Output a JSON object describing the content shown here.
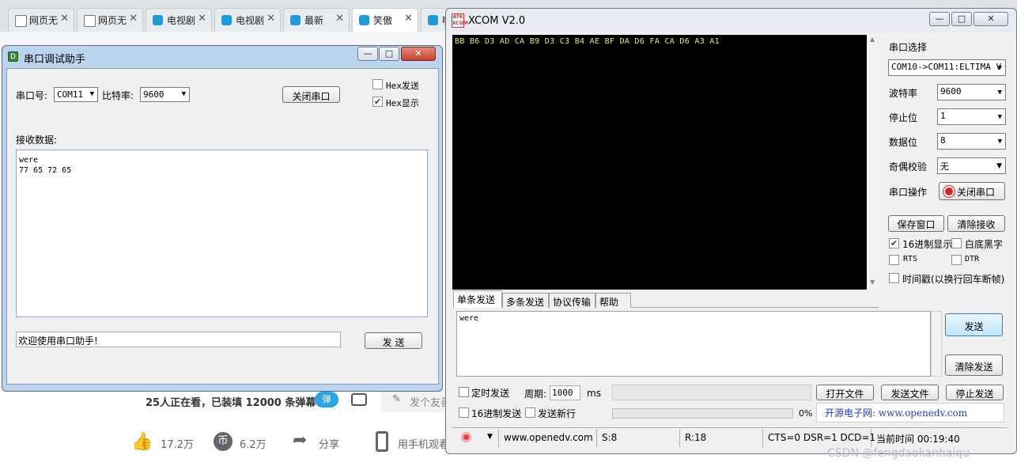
{
  "browser": {
    "tabs": [
      {
        "label": "网页无"
      },
      {
        "label": "网页无"
      },
      {
        "label": "电视剧"
      },
      {
        "label": "电视剧"
      },
      {
        "label": "最新"
      },
      {
        "label": "笑傲"
      },
      {
        "label": "嗨"
      }
    ],
    "close_glyph": "✕",
    "viewer_text": "25人正在看，已装填 12000 条弹幕",
    "danmaku_toggle": "弹",
    "danmaku_input_placeholder": "发个友善",
    "likes": "17.2万",
    "coins": "6.2万",
    "share": "分享",
    "phone_watch": "用手机观看"
  },
  "serial_assistant": {
    "title": "串口调试助手",
    "port_label": "串口号:",
    "port_value": "COM11",
    "baud_label": "比特率:",
    "baud_value": "9600",
    "close_port_button": "关闭串口",
    "hex_send_label": "Hex发送",
    "hex_send_checked": false,
    "hex_show_label": "Hex显示",
    "hex_show_checked": true,
    "receive_label": "接收数据:",
    "receive_line1": "were",
    "receive_line2": "77 65 72 65",
    "send_input_value": "欢迎使用串口助手!",
    "send_button": "发 送"
  },
  "xcom": {
    "title": "XCOM V2.0",
    "logo_text": "ATK XCOM",
    "terminal_text": "BB B6 D3 AD CA B9 D3 C3 B4 AE BF DA D6 FA CA D6 A3 A1",
    "port_select_label": "串口选择",
    "port_select_value": "COM10->COM11:ELTIMA V",
    "baud_label": "波特率",
    "baud_value": "9600",
    "stopbits_label": "停止位",
    "stopbits_value": "1",
    "databits_label": "数据位",
    "databits_value": "8",
    "parity_label": "奇偶校验",
    "parity_value": "无",
    "port_op_label": "串口操作",
    "close_port_button": "关闭串口",
    "save_window_button": "保存窗口",
    "clear_receive_button": "清除接收",
    "hex_display_label": "16进制显示",
    "hex_display_checked": true,
    "white_bg_label": "白底黑字",
    "white_bg_checked": false,
    "rts_label": "RTS",
    "dtr_label": "DTR",
    "timestamp_label": "时间戳(以换行回车断帧)",
    "tabs": [
      {
        "label": "单条发送"
      },
      {
        "label": "多条发送"
      },
      {
        "label": "协议传输"
      },
      {
        "label": "帮助"
      }
    ],
    "send_text": "were",
    "send_button": "发送",
    "clear_send_button": "清除发送",
    "timed_send_label": "定时发送",
    "period_label": "周期:",
    "period_value": "1000",
    "period_unit": "ms",
    "open_file_button": "打开文件",
    "send_file_button": "发送文件",
    "stop_send_button": "停止发送",
    "hex_send_label": "16进制发送",
    "send_newline_label": "发送新行",
    "progress_text": "0%",
    "progress_value": 0,
    "website_banner": "开源电子网: www.openedv.com",
    "status_url": "www.openedv.com",
    "status_sent": "S:8",
    "status_received": "R:18",
    "status_lines": "CTS=0 DSR=1 DCD=1",
    "status_time": "当前时间 00:19:40",
    "watermark": "CSDN @fengdaokanhaiqu"
  },
  "colors": {
    "terminal_bg": "#000000",
    "terminal_text": "#e9ec5a",
    "banner_text": "#1f3fbf",
    "record_red": "#e02020"
  }
}
